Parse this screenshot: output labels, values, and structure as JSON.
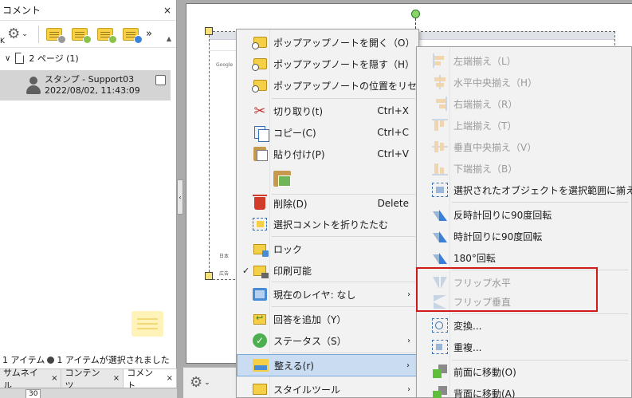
{
  "left_panel": {
    "title": "コメント",
    "close": "×",
    "toolbar": {
      "settings_caret": "⌄",
      "more": "»",
      "k_label": "K"
    },
    "page_group": {
      "chevron": "∨",
      "label": "2 ページ (1)"
    },
    "comment": {
      "title": "スタンプ - Support03",
      "datetime": "2022/08/02, 11:43:09"
    },
    "status": {
      "count_text": "1 アイテム",
      "selected_text": "1 アイテムが選択されました"
    },
    "tabs": [
      {
        "label": "サムネイル",
        "close": "×"
      },
      {
        "label": "コンテンツ",
        "close": "×"
      },
      {
        "label": "コメント",
        "close": "×"
      }
    ],
    "page_number": "30"
  },
  "collapse_arrow": "‹",
  "document": {
    "embedded_text_1": "Google",
    "embedded_text_2": "日本",
    "embedded_text_3": "広告"
  },
  "context_menu": {
    "items": [
      {
        "label": "ポップアップノートを開く（O）",
        "shortcut": ""
      },
      {
        "label": "ポップアップノートを隠す（H）",
        "shortcut": ""
      },
      {
        "label": "ポップアップノートの位置をリセット（R）",
        "shortcut": ""
      },
      {
        "label": "切り取り(t)",
        "shortcut": "Ctrl+X"
      },
      {
        "label": "コピー(C)",
        "shortcut": "Ctrl+C"
      },
      {
        "label": "貼り付け(P)",
        "shortcut": "Ctrl+V"
      },
      {
        "label": "",
        "shortcut": ""
      },
      {
        "label": "削除(D)",
        "shortcut": "Delete"
      },
      {
        "label": "選択コメントを折りたたむ",
        "shortcut": ""
      },
      {
        "label": "ロック",
        "shortcut": ""
      },
      {
        "label": "印刷可能",
        "shortcut": "",
        "checked": "✓"
      },
      {
        "label": "現在のレイヤ: なし",
        "shortcut": "",
        "arrow": "›"
      },
      {
        "label": "回答を追加（Y）",
        "shortcut": ""
      },
      {
        "label": "ステータス（S）",
        "shortcut": "",
        "arrow": "›"
      },
      {
        "label": "整える(r)",
        "shortcut": "",
        "arrow": "›"
      },
      {
        "label": "スタイルツール",
        "shortcut": "",
        "arrow": "›"
      }
    ]
  },
  "submenu": {
    "items": [
      {
        "label": "左端揃え（L）",
        "disabled": true
      },
      {
        "label": "水平中央揃え（H）",
        "disabled": true
      },
      {
        "label": "右端揃え（R）",
        "disabled": true
      },
      {
        "label": "上端揃え（T）",
        "disabled": true
      },
      {
        "label": "垂直中央揃え（V）",
        "disabled": true
      },
      {
        "label": "下端揃え（B）",
        "disabled": true
      },
      {
        "label": "選択されたオブジェクトを選択範囲に揃える",
        "arrow": "›"
      },
      {
        "label": "反時計回りに90度回転"
      },
      {
        "label": "時計回りに90度回転"
      },
      {
        "label": "180°回転"
      },
      {
        "label": "フリップ水平",
        "disabled": true
      },
      {
        "label": "フリップ垂直",
        "disabled": true
      },
      {
        "label": "変換..."
      },
      {
        "label": "重複..."
      },
      {
        "label": "前面に移動(O)"
      },
      {
        "label": "背面に移動(A)"
      }
    ]
  },
  "colors": {
    "highlight": "#c9dcf2",
    "red_box": "#d11a1a",
    "note_yellow": "#f5cf45"
  }
}
